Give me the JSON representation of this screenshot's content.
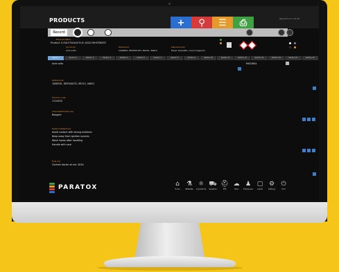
{
  "app": {
    "title": "PRODUCTS",
    "record_info": "Record 1 to 1 of 15",
    "brand": "PARATOX"
  },
  "actions": [
    {
      "label": "New",
      "glyph": "+"
    },
    {
      "label": "Search",
      "glyph": "⚲"
    },
    {
      "label": "List",
      "glyph": "☰"
    },
    {
      "label": "Print",
      "glyph": "⎙"
    }
  ],
  "toolbar": {
    "record_label": "Record"
  },
  "header": {
    "product_name_label": "Product Name",
    "product_name": "Product 4-SULFOSALICYLIC ACID DIHYDRATE",
    "synonym_label": "Synonym",
    "synonym": "Acid sulfo",
    "reference_label": "Reference",
    "reference": "1008281, 8D3500152, 89215, 40612",
    "manufacturer_label": "Manufacturer",
    "manufacturer": "Fisher Scientific / Acros Organics"
  },
  "tabs": [
    "Section 1",
    "Section 2",
    "Section 3",
    "Section 4",
    "Section 5",
    "Section 6",
    "Section 7",
    "Section 8",
    "Section 9",
    "Section 10",
    "Section 11",
    "Section 12",
    "Section 13",
    "Section 14",
    "Section 15",
    "Section 16"
  ],
  "content": {
    "acid_sulfo": "Acid sulfo",
    "reference_code": "M022604",
    "references_label": "References",
    "references": "1008281, 8D3500152, 89215, 40612",
    "product_code_label": "Product code",
    "product_code": "1114450",
    "intended_use_label": "Intended/limited use",
    "intended_use": "Reagent",
    "hazard_label": "Hazard statement",
    "hazard_lines": [
      "Avoid contact with strong oxidisers",
      "Keep away from ignition sources",
      "Wash hands after handling",
      "Handle with care"
    ],
    "first_aid_label": "First aid",
    "first_aid": "Contact doctor at ext. 4030"
  },
  "modules": [
    {
      "label": "Home",
      "glyph": "⌂"
    },
    {
      "label": "Products",
      "glyph": "⚗"
    },
    {
      "label": "Ingredients",
      "glyph": "⚛"
    },
    {
      "label": "Suppliers",
      "glyph": "⛟"
    },
    {
      "label": "PPE",
      "glyph": "⛑"
    },
    {
      "label": "Sites",
      "glyph": "☁"
    },
    {
      "label": "Employees",
      "glyph": "♟"
    },
    {
      "label": "Labels",
      "glyph": "▢"
    },
    {
      "label": "Settings",
      "glyph": "⚙"
    },
    {
      "label": "Quit",
      "glyph": "⏻"
    }
  ],
  "colors": {
    "background": "#f5c518",
    "new": "#2a6fd0",
    "search": "#d63b3b",
    "list": "#e69a2a",
    "print": "#3fa142",
    "section_label": "#e8913a",
    "active_tab": "#6fa4d8"
  }
}
